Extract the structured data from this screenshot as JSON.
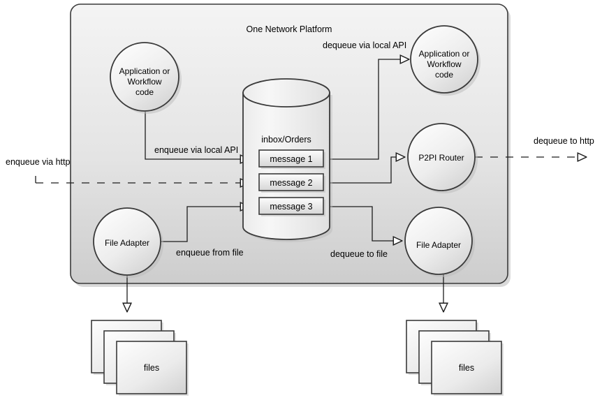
{
  "diagram": {
    "title": "One Network Platform",
    "platform": {
      "label": "One Network Platform"
    },
    "nodes": {
      "app_left": {
        "label_line1": "Application or",
        "label_line2": "Workflow",
        "label_line3": "code",
        "name": "Application or Workflow code"
      },
      "app_right": {
        "label_line1": "Application or",
        "label_line2": "Workflow",
        "label_line3": "code",
        "name": "Application or Workflow code"
      },
      "router": {
        "label": "P2PI Router"
      },
      "file_adapter_left": {
        "label": "File Adapter"
      },
      "file_adapter_right": {
        "label": "File Adapter"
      },
      "queue": {
        "label": "inbox/Orders"
      },
      "files_left": {
        "label": "files"
      },
      "files_right": {
        "label": "files"
      }
    },
    "messages": [
      {
        "label": "message 1"
      },
      {
        "label": "message 2"
      },
      {
        "label": "message 3"
      }
    ],
    "edges": [
      {
        "id": "enqueue-via-local-api",
        "label": "enqueue via local API"
      },
      {
        "id": "enqueue-via-http",
        "label": "enqueue via http"
      },
      {
        "id": "enqueue-from-file",
        "label": "enqueue from file"
      },
      {
        "id": "dequeue-via-local-api",
        "label": "dequeue via local API"
      },
      {
        "id": "dequeue-to-http",
        "label": "dequeue to http"
      },
      {
        "id": "dequeue-to-file",
        "label": "dequeue to file"
      }
    ],
    "colors": {
      "stroke": "#333333",
      "shape_fill_light": "#fbfbfb",
      "shape_fill_dark": "#d5d5d5",
      "platform_fill_top": "#f2f2f2",
      "platform_fill_bottom": "#cfcfcf",
      "message_fill_top": "#fcfcfc",
      "message_fill_bottom": "#d8d8d8",
      "background": "#ffffff",
      "shadow": "#b8b8b8"
    }
  }
}
